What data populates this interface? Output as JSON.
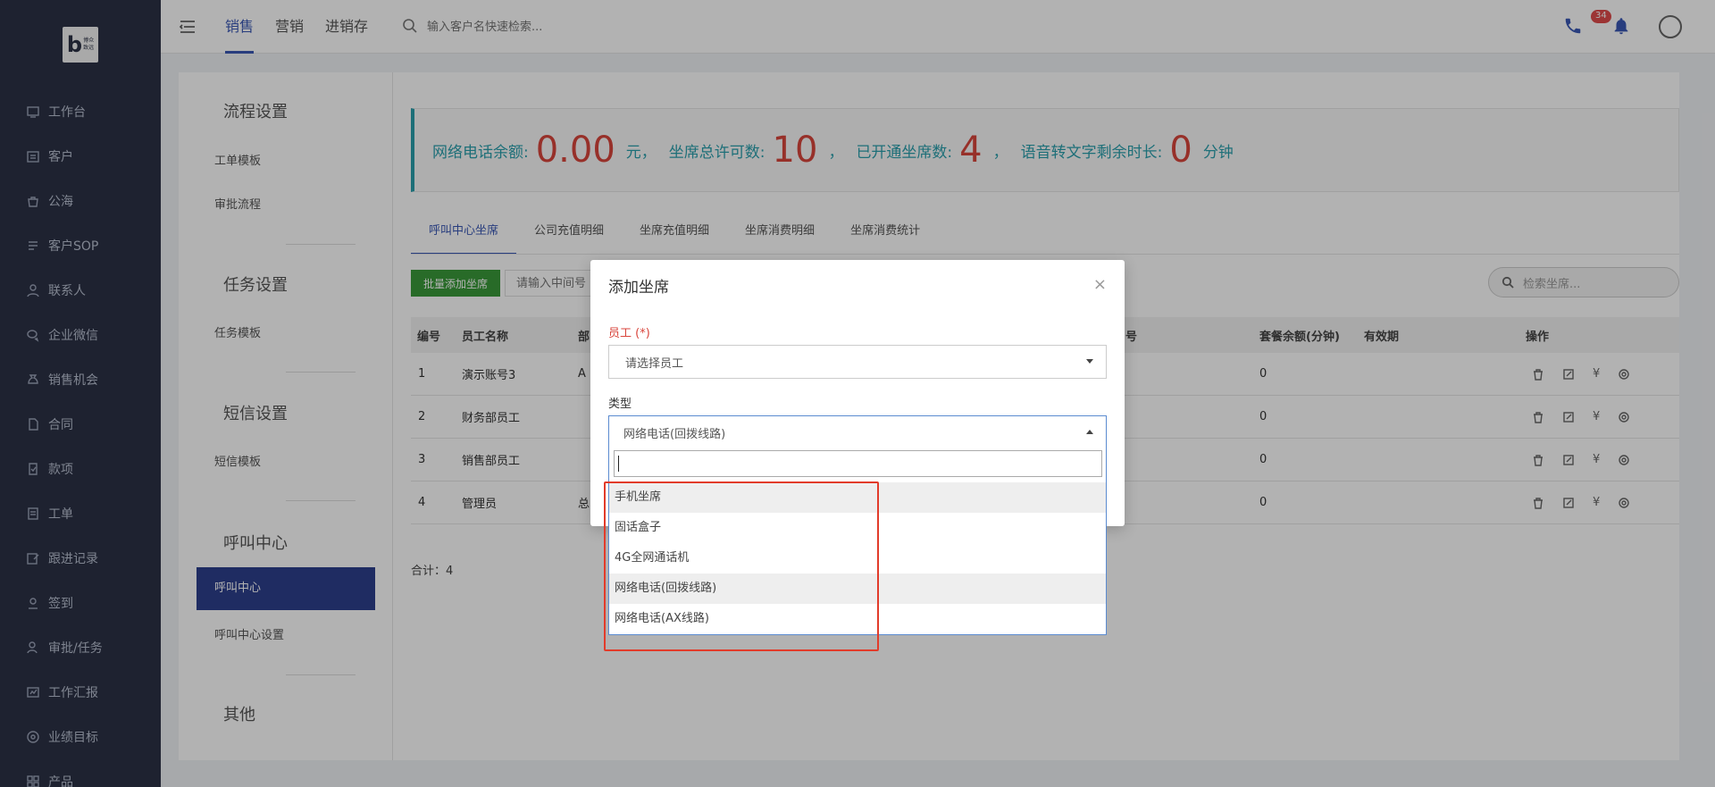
{
  "logo": {
    "text": "博众\n致远"
  },
  "sidebar": {
    "items": [
      {
        "label": "工作台",
        "icon": "dashboard-icon"
      },
      {
        "label": "客户",
        "icon": "customer-icon"
      },
      {
        "label": "公海",
        "icon": "public-pool-icon"
      },
      {
        "label": "客户SOP",
        "icon": "sop-icon"
      },
      {
        "label": "联系人",
        "icon": "contact-icon"
      },
      {
        "label": "企业微信",
        "icon": "wechat-icon"
      },
      {
        "label": "销售机会",
        "icon": "money-bag-icon"
      },
      {
        "label": "合同",
        "icon": "contract-icon"
      },
      {
        "label": "款项",
        "icon": "payment-icon"
      },
      {
        "label": "工单",
        "icon": "ticket-icon"
      },
      {
        "label": "跟进记录",
        "icon": "edit-note-icon"
      },
      {
        "label": "签到",
        "icon": "checkin-icon"
      },
      {
        "label": "审批/任务",
        "icon": "approval-icon"
      },
      {
        "label": "工作汇报",
        "icon": "report-icon"
      },
      {
        "label": "业绩目标",
        "icon": "target-icon"
      },
      {
        "label": "产品",
        "icon": "product-icon"
      }
    ]
  },
  "topbar": {
    "tabs": [
      "销售",
      "营销",
      "进销存"
    ],
    "active_tab": "销售",
    "search_placeholder": "输入客户名快速检索...",
    "notification_count": "34"
  },
  "left_panel": {
    "sections": [
      {
        "title": "流程设置",
        "links": [
          "工单模板",
          "审批流程"
        ]
      },
      {
        "title": "任务设置",
        "links": [
          "任务模板"
        ]
      },
      {
        "title": "短信设置",
        "links": [
          "短信模板"
        ]
      },
      {
        "title": "呼叫中心",
        "links": [
          "呼叫中心",
          "呼叫中心设置"
        ]
      },
      {
        "title": "其他",
        "links": []
      }
    ],
    "active_link": "呼叫中心"
  },
  "stats": {
    "balance_label": "网络电话余额:",
    "balance_value": "0.00",
    "balance_unit": "元，",
    "total_seats_label": "坐席总许可数:",
    "total_seats_value": "10",
    "sep1": "，",
    "open_seats_label": "已开通坐席数:",
    "open_seats_value": "4",
    "sep2": "，",
    "speech_label": "语音转文字剩余时长:",
    "speech_value": "0",
    "speech_unit": "分钟"
  },
  "tabs": [
    "呼叫中心坐席",
    "公司充值明细",
    "坐席充值明细",
    "坐席消费明细",
    "坐席消费统计"
  ],
  "active_tab": "呼叫中心坐席",
  "toolbar": {
    "batch_add_label": "批量添加坐席",
    "middle_placeholder": "请输入中间号",
    "seat_search_placeholder": "检索坐席..."
  },
  "table": {
    "headers": {
      "no": "编号",
      "name": "员工名称",
      "dept": "部",
      "number": "号",
      "balance": "套餐余额(分钟)",
      "validity": "有效期",
      "ops": "操作"
    },
    "rows": [
      {
        "no": "1",
        "name": "演示账号3",
        "dept": "A",
        "balance": "0"
      },
      {
        "no": "2",
        "name": "财务部员工",
        "dept": "",
        "balance": "0"
      },
      {
        "no": "3",
        "name": "销售部员工",
        "dept": "",
        "balance": "0"
      },
      {
        "no": "4",
        "name": "管理员",
        "dept": "总",
        "balance": "0"
      }
    ],
    "total": "合计：4"
  },
  "modal": {
    "title": "添加坐席",
    "close": "×",
    "employee_label": "员工 (*)",
    "employee_placeholder": "请选择员工",
    "type_label": "类型",
    "type_value": "网络电话(回拨线路)"
  },
  "dropdown": {
    "options": [
      "手机坐席",
      "固话盒子",
      "4G全网通话机",
      "网络电话(回拨线路)",
      "网络电话(AX线路)"
    ],
    "hovered": "手机坐席",
    "selected": "网络电话(回拨线路)"
  },
  "colors": {
    "brand": "#3a58b5",
    "sidebar": "#2b3245",
    "stat_text": "#2a9fad",
    "stat_number": "#d9453c",
    "highlight_box": "#e23b2a"
  }
}
